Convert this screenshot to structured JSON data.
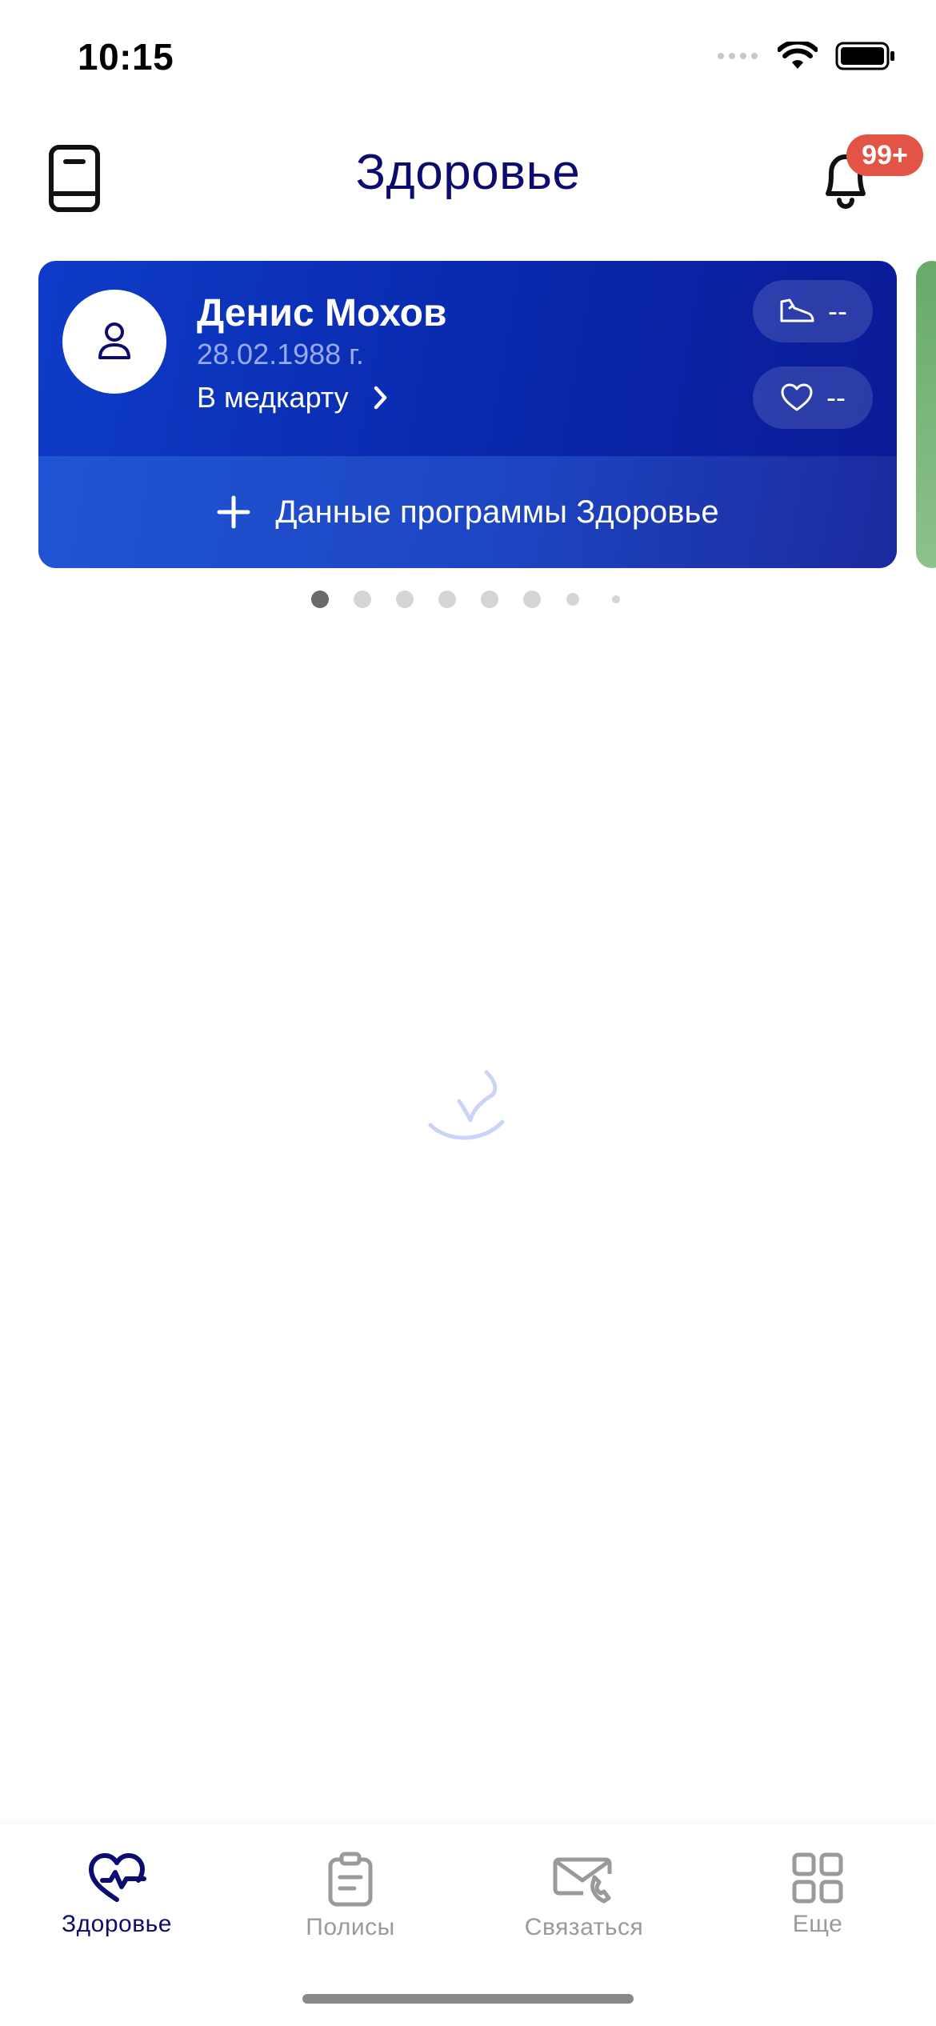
{
  "status_bar": {
    "time": "10:15",
    "icons": [
      "signal-icon",
      "wifi-icon",
      "battery-icon"
    ]
  },
  "header": {
    "title": "Здоровье",
    "left_icon": "book-icon",
    "right_icon": "bell-icon",
    "notification_badge": "99+"
  },
  "profile_card": {
    "name": "Денис Мохов",
    "dob": "28.02.1988 г.",
    "medcard_link": "В медкарту",
    "steps_value": "--",
    "heart_value": "--",
    "add_health_data": "Данные программы Здоровье"
  },
  "pager": {
    "total": 8,
    "active_index": 0
  },
  "tabs": [
    {
      "label": "Здоровье",
      "icon": "heart-pulse-icon",
      "active": true
    },
    {
      "label": "Полисы",
      "icon": "clipboard-icon",
      "active": false
    },
    {
      "label": "Связаться",
      "icon": "contact-mail-icon",
      "active": false
    },
    {
      "label": "Еще",
      "icon": "grid-icon",
      "active": false
    }
  ],
  "colors": {
    "brand_dark": "#0c0c70",
    "card_blue": "#0a2bb0",
    "badge_red": "#e25446",
    "inactive": "#9a9a9a"
  }
}
